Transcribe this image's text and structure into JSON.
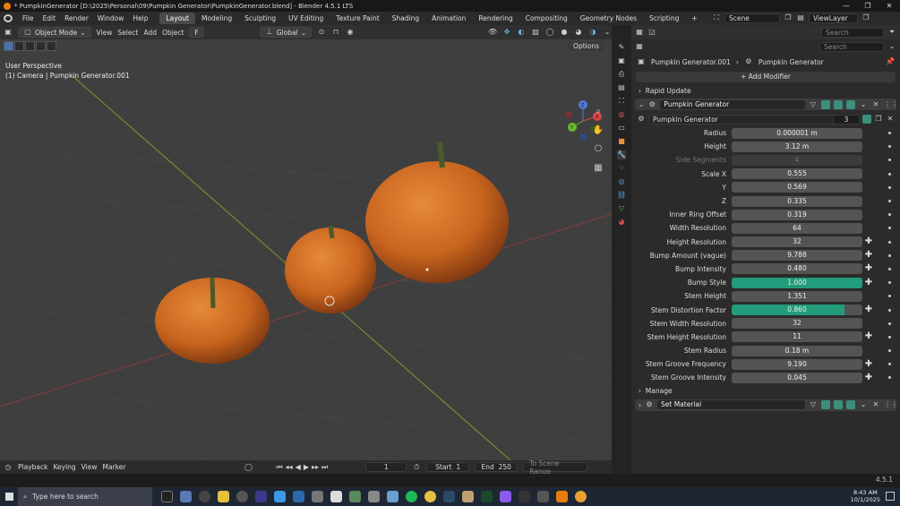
{
  "window": {
    "title": "* PumpkinGenerator [D:\\2025\\Personal\\09\\Pumpkin Generator\\PumpkinGenerator.blend] - Blender 4.5.1 LTS",
    "controls": [
      "—",
      "❐",
      "✕"
    ]
  },
  "menu": {
    "items": [
      "File",
      "Edit",
      "Render",
      "Window",
      "Help"
    ],
    "workspaces": [
      "Layout",
      "Modeling",
      "Sculpting",
      "UV Editing",
      "Texture Paint",
      "Shading",
      "Animation",
      "Rendering",
      "Compositing",
      "Geometry Nodes",
      "Scripting"
    ],
    "active_workspace": "Layout",
    "add_tab": "+",
    "scene": "Scene",
    "view_layer": "ViewLayer"
  },
  "viewport_header": {
    "mode": "Object Mode",
    "menus": [
      "View",
      "Select",
      "Add",
      "Object"
    ],
    "object_hotkey": "F",
    "orientation": "Global"
  },
  "viewport": {
    "perspective": "User Perspective",
    "object_info": "(1) Camera | Pumpkin Generator.001",
    "options": "Options",
    "gizmo": {
      "x": "X",
      "y": "Y",
      "z": "Z"
    }
  },
  "timeline": {
    "menus": [
      "Playback",
      "Keying",
      "View",
      "Marker"
    ],
    "current_frame": "1",
    "start_label": "Start",
    "start": "1",
    "end_label": "End",
    "end": "250",
    "scene_range": "To Scene Range"
  },
  "version": "4.5.1",
  "properties": {
    "search_placeholder": "Search",
    "breadcrumb": {
      "object": "Pumpkin Generator.001",
      "modifier": "Pumpkin Generator"
    },
    "add_modifier": "Add Modifier",
    "rapid_update": "Rapid Update",
    "modifier_name": "Pumpkin Generator",
    "node_group": {
      "name": "Pumpkin Generator",
      "users": "3"
    },
    "fields": [
      {
        "label": "Radius",
        "value": "0.000001 m"
      },
      {
        "label": "Height",
        "value": "3.12 m"
      },
      {
        "label": "Side Segments",
        "value": "4",
        "disabled": true
      },
      {
        "label": "Scale X",
        "value": "0.555"
      },
      {
        "label": "Y",
        "value": "0.569"
      },
      {
        "label": "Z",
        "value": "0.335"
      },
      {
        "label": "Inner Ring Offset",
        "value": "0.319"
      },
      {
        "label": "Width Resolution",
        "value": "64"
      },
      {
        "label": "Height Resolution",
        "value": "32",
        "plus": true
      },
      {
        "label": "Bump Amount (vague)",
        "value": "9.788",
        "plus": true
      },
      {
        "label": "Bump Intensity",
        "value": "0.480",
        "plus": true
      },
      {
        "label": "Bump Style",
        "value": "1.000",
        "fill": 1.0,
        "plus": true
      },
      {
        "label": "Stem Height",
        "value": "1.351"
      },
      {
        "label": "Stem Distortion Factor",
        "value": "0.860",
        "fill": 0.86,
        "plus": true
      },
      {
        "label": "Stem Width Resolution",
        "value": "32"
      },
      {
        "label": "Stem Height Resolution",
        "value": "11",
        "plus": true
      },
      {
        "label": "Stem Radius",
        "value": "0.18 m"
      },
      {
        "label": "Stem Groove Frequency",
        "value": "9.190",
        "plus": true
      },
      {
        "label": "Stem Groove Intensity",
        "value": "0.045",
        "plus": true
      }
    ],
    "manage": "Manage",
    "set_material": "Set Material"
  },
  "taskbar": {
    "search_placeholder": "Type here to search",
    "time": "8:43 AM",
    "date": "10/1/2025"
  },
  "colors": {
    "accent": "#229c7b",
    "pumpkin": "#d9772a",
    "stem": "#4a5a2a",
    "grid_x": "#8a3a3a",
    "grid_y": "#7d9a2a"
  }
}
